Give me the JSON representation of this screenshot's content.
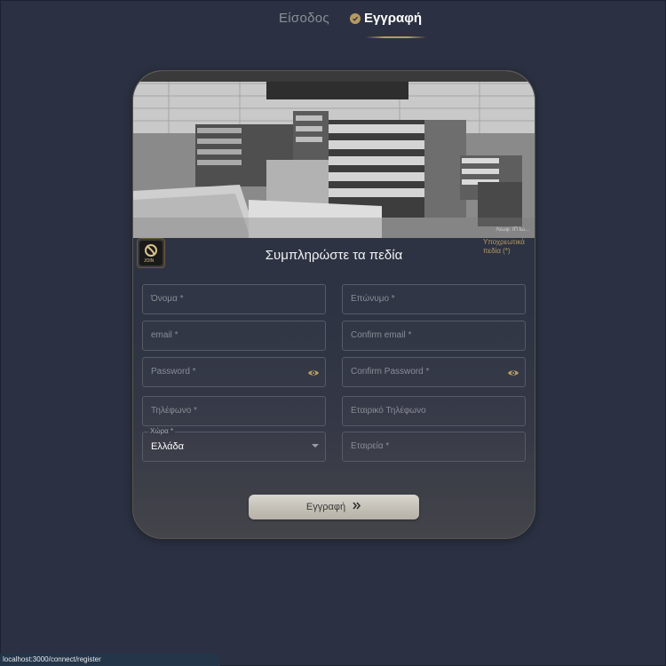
{
  "tabs": {
    "login_label": "Είσοδος",
    "register_label": "Εγγραφή"
  },
  "hero": {
    "image_icon": "warehouse-photo",
    "credit": "Λεωφ. ΙΠ Ιω..."
  },
  "form": {
    "title": "Συμπληρώστε τα πεδία",
    "required_note": "Υποχρεωτικά πεδία (*)",
    "fields": {
      "first_name": "Όνομα *",
      "last_name": "Επώνυμο *",
      "email": "email *",
      "confirm_email": "Confirm email *",
      "password": "Password *",
      "confirm_password": "Confirm Password *",
      "phone": "Τηλέφωνο *",
      "company_phone": "Εταιρικό Τηλέφωνο",
      "country_label": "Χώρα *",
      "country_value": "Ελλάδα",
      "company": "Εταιρεία *"
    },
    "submit_label": "Εγγραφή"
  },
  "logo": {
    "text": "JOIN"
  },
  "status_bar": {
    "url": "localhost:3000/connect/register"
  },
  "colors": {
    "background": "#2b3142",
    "accent_gold": "#b59a62",
    "field_border": "#565b66",
    "button": "#c3beb4"
  }
}
